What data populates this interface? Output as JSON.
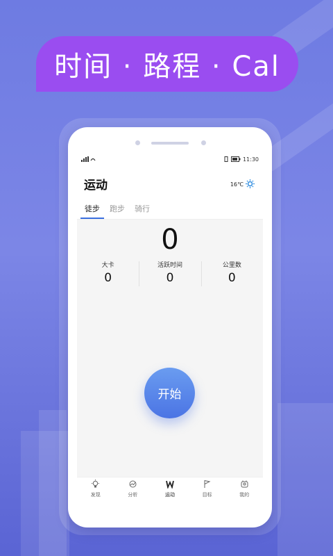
{
  "banner": {
    "text": "时间 · 路程 · Cal"
  },
  "status_bar": {
    "time": "11:30"
  },
  "header": {
    "title": "运动",
    "temperature": "16℃",
    "weather_icon": "sun-icon"
  },
  "tabs": [
    {
      "label": "徒步",
      "active": true
    },
    {
      "label": "跑步",
      "active": false
    },
    {
      "label": "骑行",
      "active": false
    }
  ],
  "main": {
    "big_value": "0",
    "stats": [
      {
        "label": "大卡",
        "value": "0"
      },
      {
        "label": "活跃时间",
        "value": "0"
      },
      {
        "label": "公里数",
        "value": "0"
      }
    ],
    "start_label": "开始"
  },
  "bottom_nav": [
    {
      "label": "发现",
      "icon": "bulb-icon"
    },
    {
      "label": "分析",
      "icon": "analysis-icon"
    },
    {
      "label": "运动",
      "icon": "run-icon",
      "active": true
    },
    {
      "label": "目标",
      "icon": "flag-icon"
    },
    {
      "label": "我的",
      "icon": "profile-icon"
    }
  ],
  "colors": {
    "banner": "#9a4df0",
    "accent": "#4b74e4",
    "background": "#6e7be2"
  }
}
